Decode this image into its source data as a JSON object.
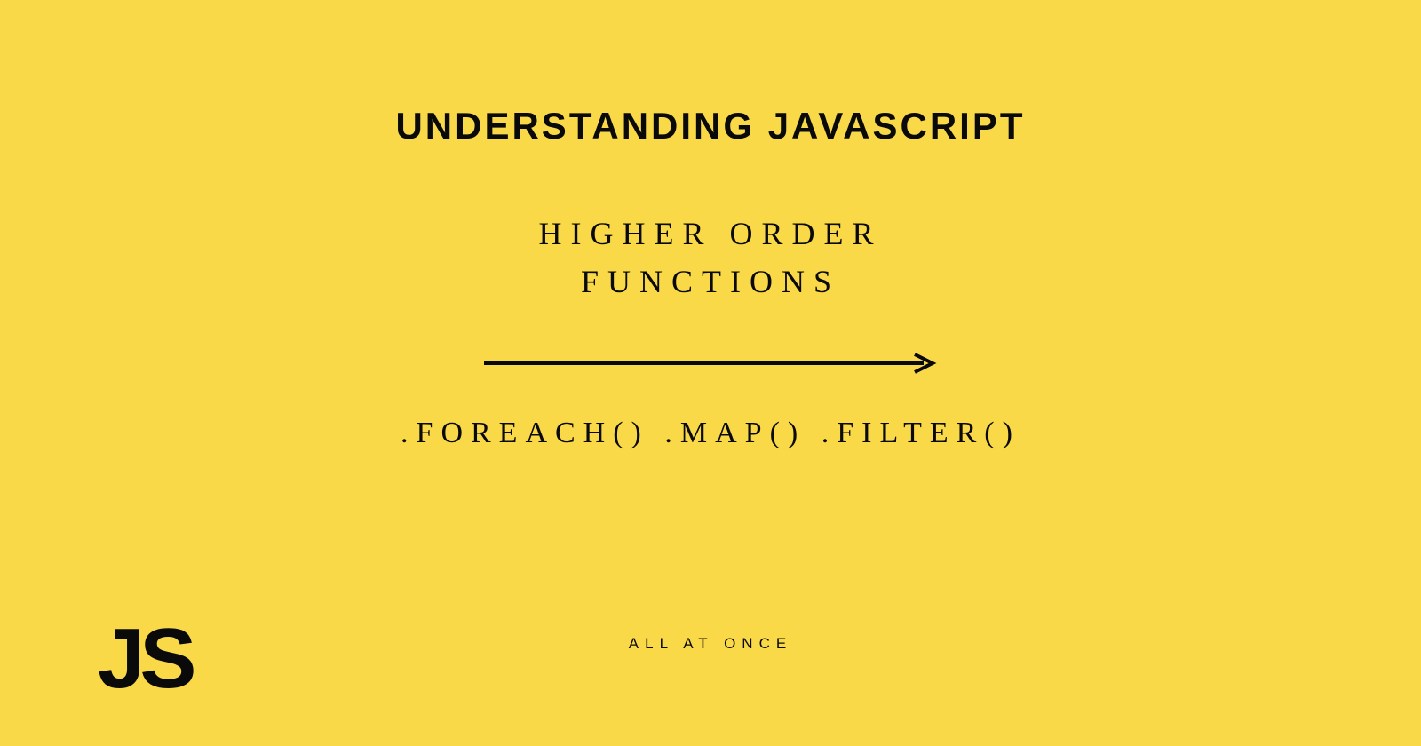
{
  "title": "UNDERSTANDING JAVASCRIPT",
  "subtitle_line1": "HIGHER ORDER",
  "subtitle_line2": "FUNCTIONS",
  "methods": ".FOREACH() .MAP() .FILTER()",
  "footer": "ALL AT ONCE",
  "logo": "JS",
  "colors": {
    "background": "#fad949",
    "text": "#0a0a0a"
  }
}
